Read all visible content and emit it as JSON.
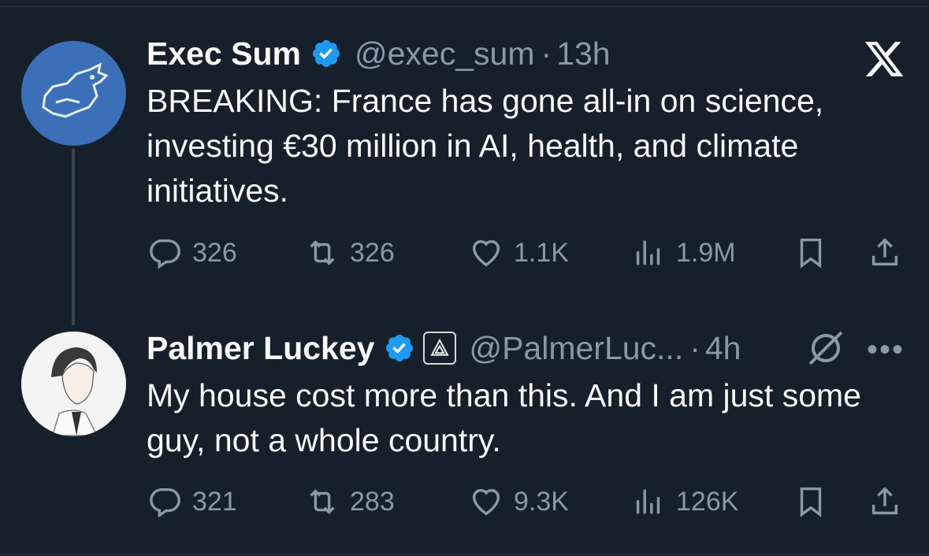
{
  "tweets": [
    {
      "name": "Exec Sum",
      "handle": "@exec_sum",
      "time": "13h",
      "text": "BREAKING: France has gone all-in on science, investing €30 million in AI, health, and climate initiatives.",
      "replies": "326",
      "retweets": "326",
      "likes": "1.1K",
      "views": "1.9M"
    },
    {
      "name": "Palmer Luckey",
      "handle": "@PalmerLuc...",
      "time": "4h",
      "text": "My house cost more than this.  And I am just some guy, not a whole country.",
      "replies": "321",
      "retweets": "283",
      "likes": "9.3K",
      "views": "126K"
    }
  ],
  "sep": "·",
  "icons": {
    "verified": "verified-badge-icon",
    "reply": "reply-icon",
    "retweet": "retweet-icon",
    "like": "heart-icon",
    "views": "views-icon",
    "bookmark": "bookmark-icon",
    "share": "share-icon",
    "brand": "x-logo-icon",
    "grok": "grok-icon",
    "more": "more-icon"
  },
  "colors": {
    "background": "#15202b",
    "text": "#f7f9f9",
    "muted": "#8b98a5",
    "verified": "#1d9bf0"
  }
}
